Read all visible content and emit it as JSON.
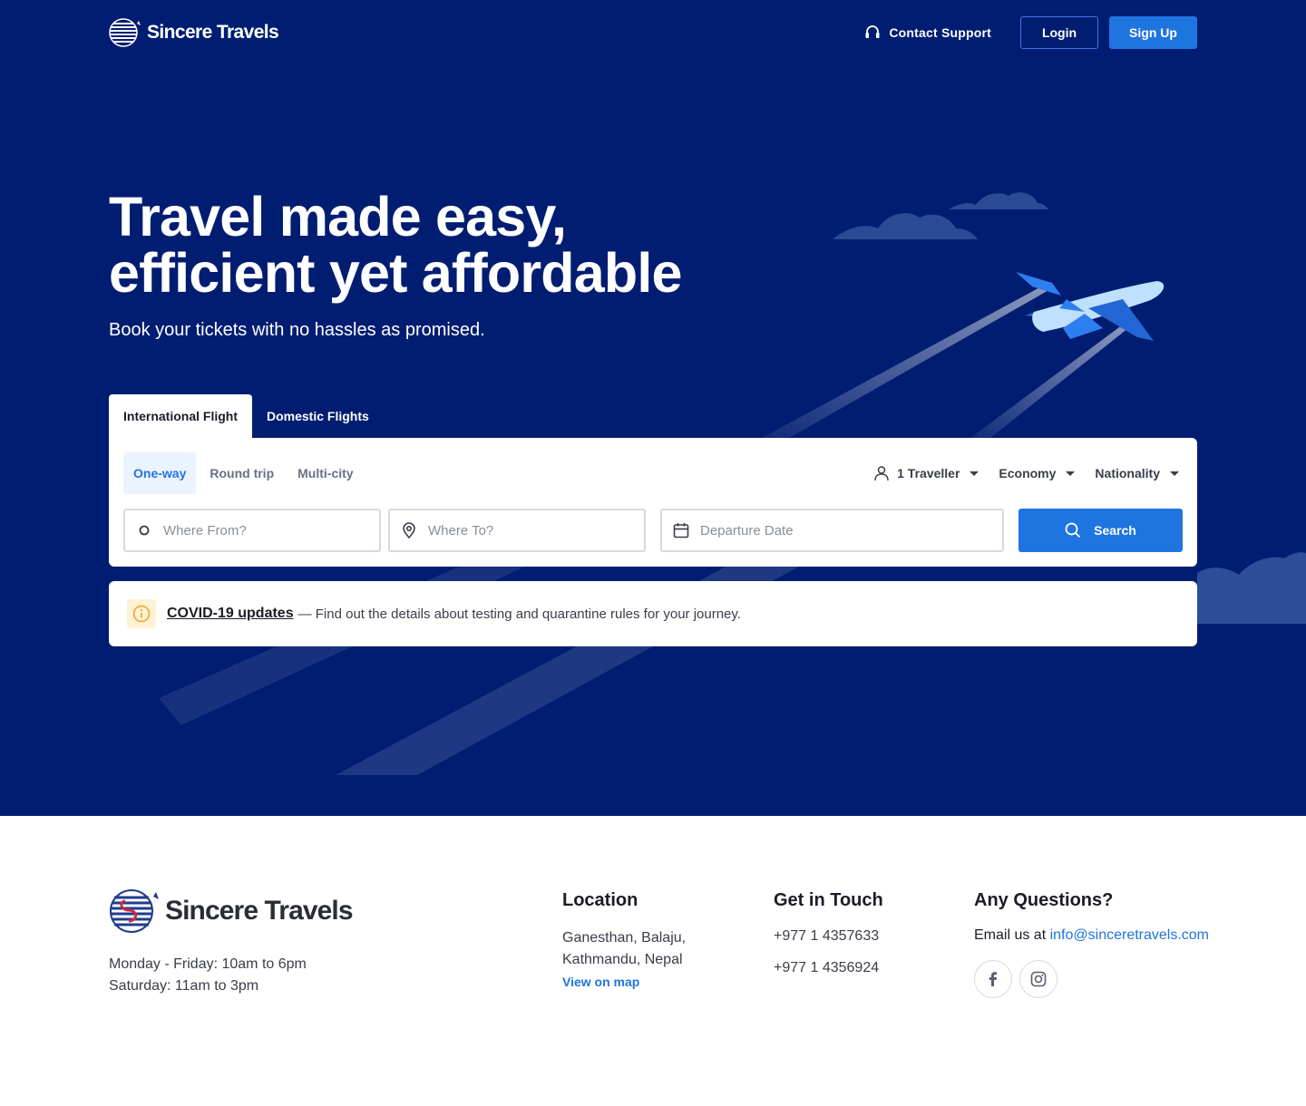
{
  "header": {
    "brand_name": "Sincere Travels",
    "support_label": "Contact Support",
    "login_label": "Login",
    "signup_label": "Sign Up"
  },
  "hero": {
    "headline_line1": "Travel made easy,",
    "headline_line2": "efficient yet affordable",
    "subtitle": "Book your tickets with no hassles as promised."
  },
  "tabs": [
    {
      "label": "International Flight",
      "active": true
    },
    {
      "label": "Domestic Flights",
      "active": false
    }
  ],
  "search": {
    "trip_types": [
      {
        "label": "One-way",
        "active": true
      },
      {
        "label": "Round trip",
        "active": false
      },
      {
        "label": "Multi-city",
        "active": false
      }
    ],
    "travellers": "1 Traveller",
    "cabin": "Economy",
    "nationality": "Nationality",
    "from_placeholder": "Where From?",
    "to_placeholder": "Where To?",
    "date_placeholder": "Departure Date",
    "button_label": "Search"
  },
  "notice": {
    "link_text": "COVID-19 updates",
    "text": "— Find out the details about testing and quarantine rules for your journey."
  },
  "footer": {
    "brand_name": "Sincere Travels",
    "hours_line1": "Monday - Friday: 10am to 6pm",
    "hours_line2": "Saturday: 11am to 3pm",
    "location": {
      "title": "Location",
      "line1": "Ganesthan, Balaju,",
      "line2": "Kathmandu, Nepal",
      "map_link": "View on map"
    },
    "contact": {
      "title": "Get in Touch",
      "phones": [
        "+977 1 4357633",
        "+977 1 4356924"
      ]
    },
    "questions": {
      "title": "Any Questions?",
      "email_prefix": "Email us at",
      "email": "info@sinceretravels.com"
    },
    "socials": [
      "facebook-icon",
      "instagram-icon"
    ]
  },
  "colors": {
    "hero_bg": "#001d72",
    "accent": "#1f75e0",
    "notice_icon_bg": "#fff1d6",
    "notice_icon": "#f5a623"
  }
}
